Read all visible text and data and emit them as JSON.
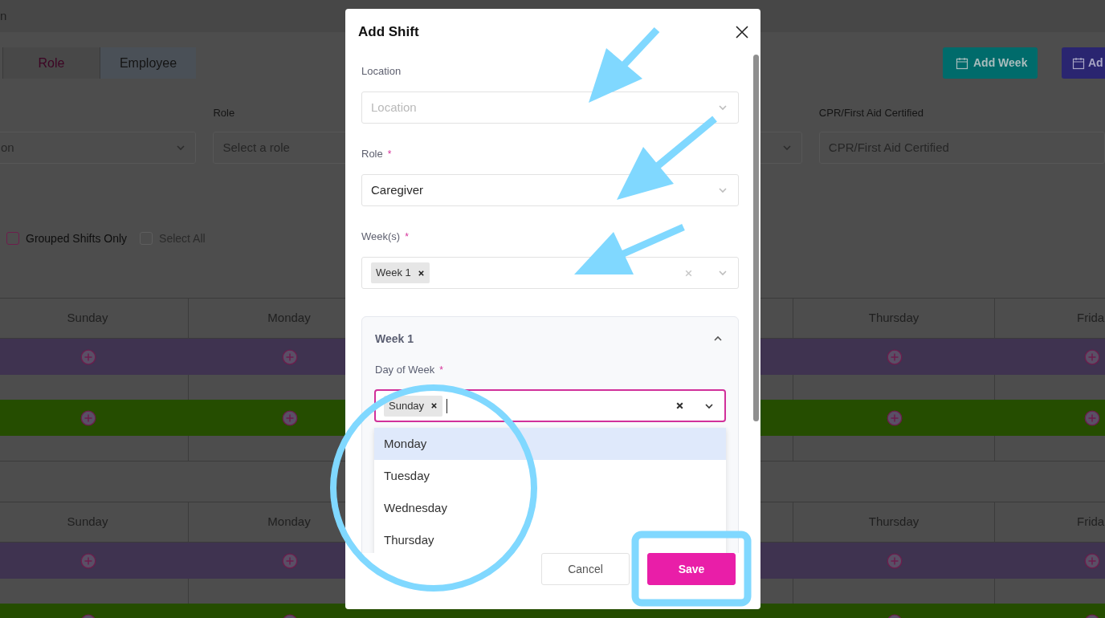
{
  "page": {
    "title_fragment": "n"
  },
  "view_tabs": [
    {
      "label": "Role",
      "selected": false
    },
    {
      "label": "Employee",
      "selected": true
    }
  ],
  "toolbar_buttons": [
    {
      "label": "Add Week",
      "kind": "teal"
    },
    {
      "label": "Ad",
      "kind": "indigo"
    }
  ],
  "filters": [
    {
      "kind": "select",
      "placeholder": "on"
    },
    {
      "kind": "select",
      "label": "Role",
      "placeholder": "Select a role"
    },
    {
      "kind": "select"
    },
    {
      "kind": "input",
      "label": "CPR/First Aid Certified",
      "placeholder": "CPR/First Aid Certified"
    }
  ],
  "options": [
    {
      "label": "Grouped Shifts Only",
      "checked": false,
      "disabled": false
    },
    {
      "label": "Select All",
      "checked": false,
      "disabled": true
    }
  ],
  "schedule": [
    {
      "days": [
        "Sunday",
        "Monday",
        "Thursday",
        "Frida"
      ],
      "bands": [
        {
          "color": "#3f3350"
        },
        {
          "color": "#254d00"
        }
      ]
    },
    {
      "days": [
        "Sunday",
        "Monday",
        "Thursday",
        "Frida"
      ],
      "bands": [
        {
          "color": "#3f3350"
        },
        {
          "color": "#254d00"
        }
      ]
    }
  ],
  "modal": {
    "title": "Add Shift",
    "fields": [
      {
        "label": "Location",
        "placeholder": "Location"
      },
      {
        "label": "Role",
        "marker": "*",
        "value": "Caregiver"
      },
      {
        "label": "Week(s)",
        "marker": "*",
        "chips": [
          "Week 1"
        ]
      }
    ],
    "week_panel": {
      "title": "Week 1",
      "expanded": true,
      "day_field": {
        "label": "Day of Week",
        "marker": "*",
        "chips": [
          "Sunday"
        ],
        "focused": true
      },
      "options": [
        {
          "label": "Monday",
          "highlighted": true
        },
        {
          "label": "Tuesday",
          "highlighted": false
        },
        {
          "label": "Wednesday",
          "highlighted": false
        },
        {
          "label": "Thursday",
          "highlighted": false
        }
      ]
    },
    "buttons": [
      {
        "label": "Cancel",
        "kind": "secondary"
      },
      {
        "label": "Save",
        "kind": "primary"
      }
    ]
  }
}
